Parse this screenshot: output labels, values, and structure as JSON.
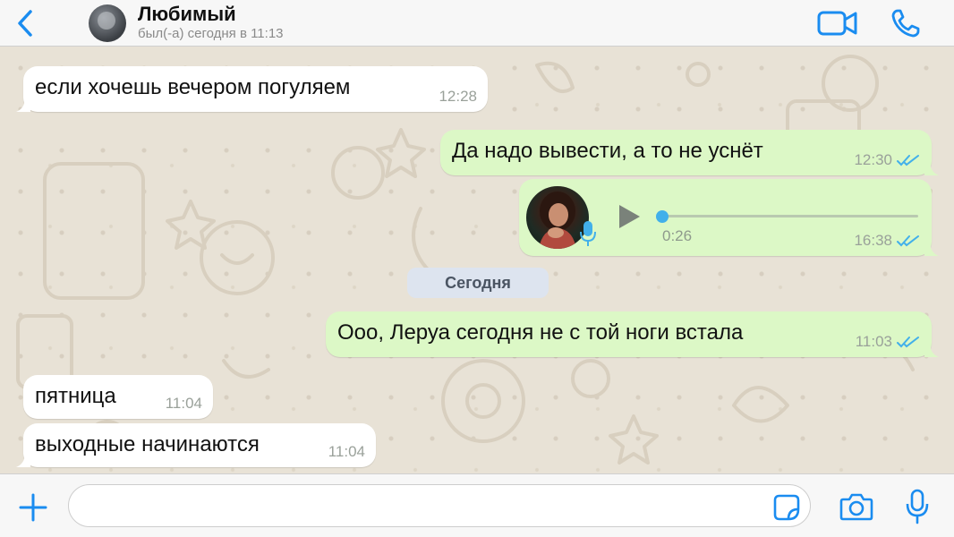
{
  "header": {
    "contact_name": "Любимый",
    "contact_status": "был(-а) сегодня в 11:13"
  },
  "messages": [
    {
      "direction": "incoming",
      "text": "если хочешь вечером погуляем",
      "time": "12:28"
    },
    {
      "direction": "outgoing",
      "text": "Да надо вывести, а то не уснёт",
      "time": "12:30",
      "status": "read"
    },
    {
      "direction": "outgoing",
      "type": "voice",
      "duration": "0:26",
      "time": "16:38",
      "status": "read",
      "progress": 0
    },
    {
      "direction": "outgoing",
      "text": "Ооо, Леруа сегодня не с той ноги встала",
      "time": "11:03",
      "status": "read"
    },
    {
      "direction": "incoming",
      "text": "пятница",
      "time": "11:04"
    },
    {
      "direction": "incoming",
      "text": "выходные начинаются",
      "time": "11:04"
    }
  ],
  "date_separator": "Сегодня",
  "composer": {
    "value": "",
    "placeholder": ""
  },
  "icons": {
    "back": "chevron-left-icon",
    "video": "video-camera-icon",
    "call": "phone-icon",
    "play": "play-icon",
    "plus": "plus-icon",
    "sticker": "sticker-icon",
    "camera": "camera-icon",
    "mic": "microphone-icon",
    "read_receipt": "double-check-icon"
  },
  "colors": {
    "accent": "#1a8cf0",
    "outgoing_bubble": "#dcf8c6",
    "incoming_bubble": "#ffffff",
    "read_ticks": "#42b0ea",
    "chat_background": "#e8e2d6"
  }
}
